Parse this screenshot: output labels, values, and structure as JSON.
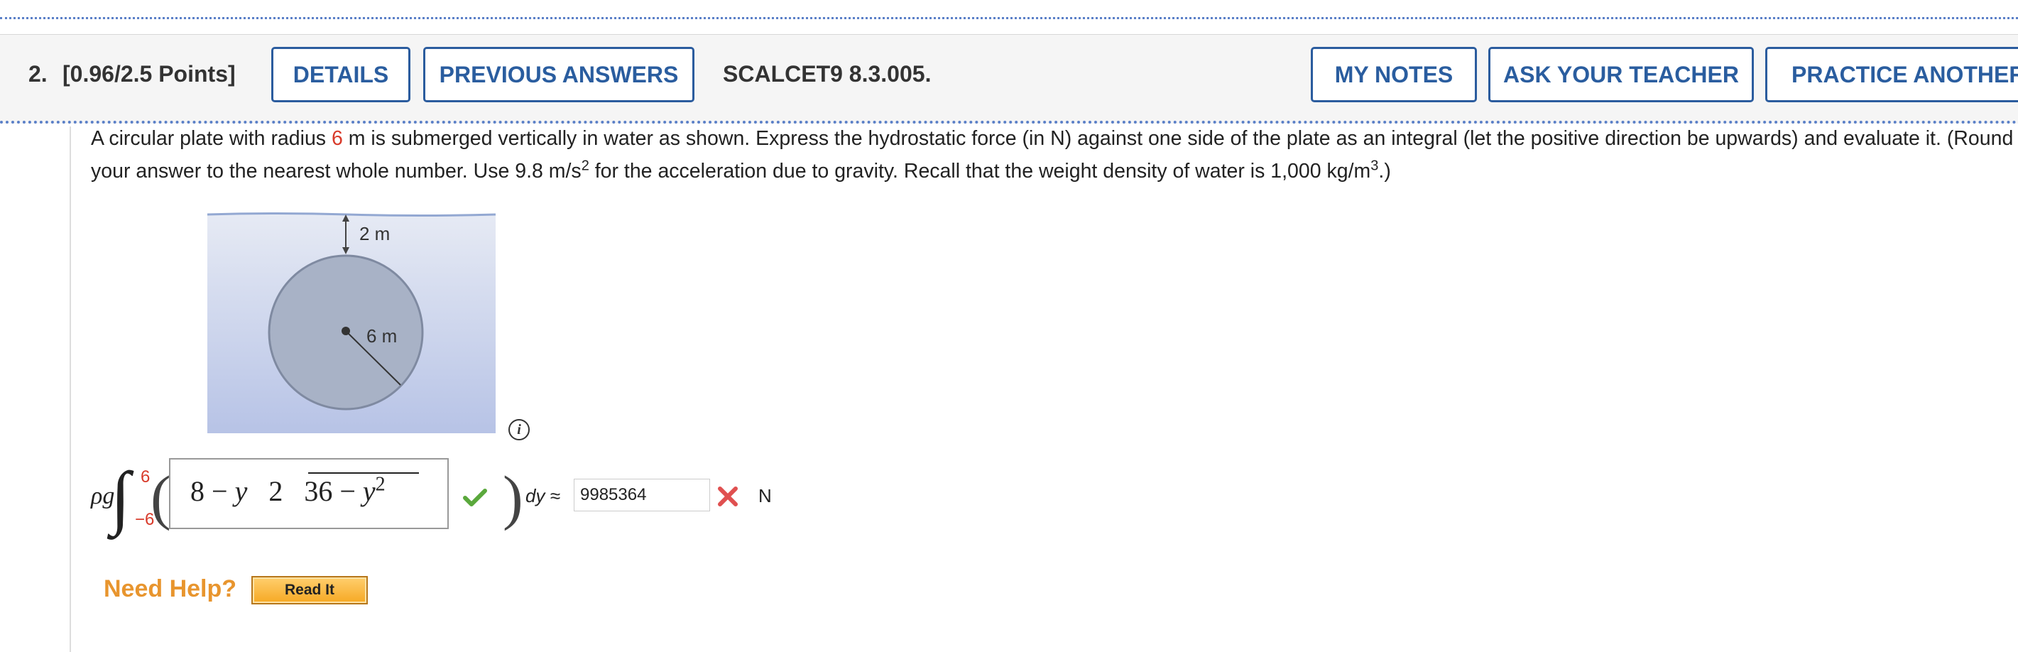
{
  "question": {
    "number": "2.",
    "points": "[0.96/2.5 Points]",
    "code": "SCALCET9 8.3.005."
  },
  "header_buttons": {
    "details": "DETAILS",
    "previous_answers": "PREVIOUS ANSWERS",
    "my_notes": "MY NOTES",
    "ask_teacher": "ASK YOUR TEACHER",
    "practice_another": "PRACTICE ANOTHER"
  },
  "prompt": {
    "p1": "A circular plate with radius ",
    "radius": "6",
    "p2": " m is submerged vertically in water as shown. Express the hydrostatic force (in N) against one side of the plate as an integral (let the positive direction be upwards) and evaluate it. (Round your answer to the nearest whole number. Use 9.8 m/s",
    "exp2": "2",
    "p3": " for the acceleration due to gravity. Recall that the weight density of water is 1,000 kg/m",
    "exp3": "3",
    "p4": ".)"
  },
  "figure": {
    "depth_label": "2 m",
    "radius_label": "6 m"
  },
  "integral": {
    "prefix": "ρg",
    "upper": "6",
    "lower": "−6",
    "integrand_part1": "8 − ",
    "integrand_var": "y",
    "integrand_part2": "   2   36 − ",
    "integrand_sq_var": "y",
    "integrand_sq_exp": "2",
    "differential": "dy ≈",
    "answer_value": "9985364",
    "unit": "N"
  },
  "help": {
    "label": "Need Help?",
    "read_it": "Read It"
  },
  "colors": {
    "accent_blue": "#2a5d9f",
    "red": "#d83a2a",
    "help_orange": "#e8952e",
    "correct_green": "#5aa83c"
  },
  "icons": [
    "info-icon",
    "checkmark-icon",
    "x-mark-icon"
  ]
}
